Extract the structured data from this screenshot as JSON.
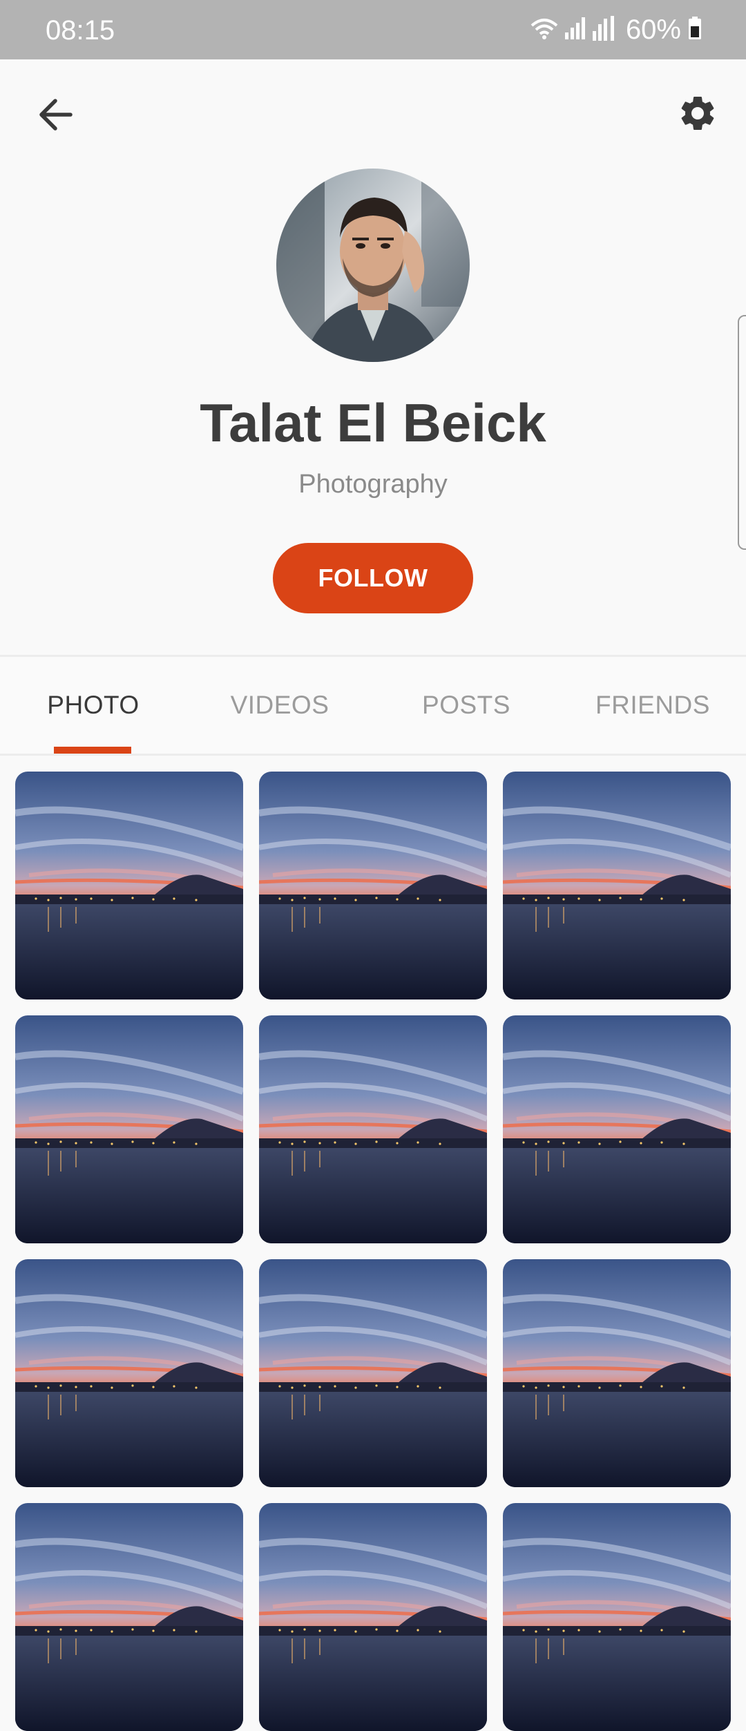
{
  "status_bar": {
    "time": "08:15",
    "battery_percent": "60%",
    "icons": [
      "wifi-icon",
      "signal-icon",
      "signal-r-icon",
      "battery-icon"
    ]
  },
  "header": {
    "back_icon": "arrow-left-icon",
    "settings_icon": "gear-icon"
  },
  "profile": {
    "name": "Talat El Beick",
    "subtitle": "Photography",
    "follow_label": "FOLLOW"
  },
  "tabs": [
    {
      "label": "PHOTO",
      "active": true
    },
    {
      "label": "VIDEOS",
      "active": false
    },
    {
      "label": "POSTS",
      "active": false
    },
    {
      "label": "FRIENDS",
      "active": false
    }
  ],
  "colors": {
    "accent": "#da4416",
    "status_bar": "#b3b3b3",
    "background": "#f9f9f9",
    "title_text": "#3d3d3d",
    "muted_text": "#8a8a8a"
  },
  "photos": [
    {
      "subject": "sunset-over-bay"
    },
    {
      "subject": "sunset-over-bay"
    },
    {
      "subject": "sunset-over-bay"
    },
    {
      "subject": "sunset-over-bay"
    },
    {
      "subject": "sunset-over-bay"
    },
    {
      "subject": "sunset-over-bay"
    },
    {
      "subject": "sunset-over-bay"
    },
    {
      "subject": "sunset-over-bay"
    },
    {
      "subject": "sunset-over-bay"
    },
    {
      "subject": "sunset-over-bay"
    },
    {
      "subject": "sunset-over-bay"
    },
    {
      "subject": "sunset-over-bay"
    }
  ]
}
